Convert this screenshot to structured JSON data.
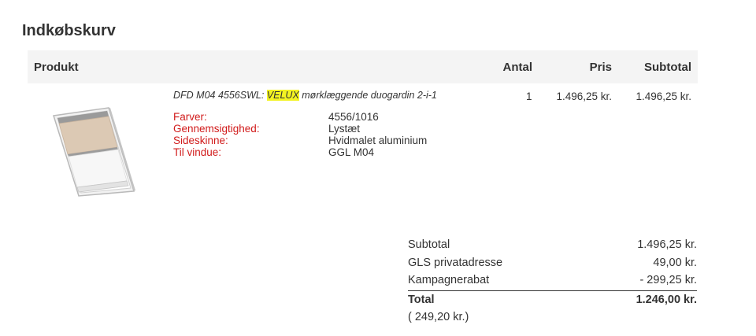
{
  "page": {
    "title": "Indkøbskurv"
  },
  "cart_header": {
    "product": "Produkt",
    "quantity": "Antal",
    "price": "Pris",
    "subtotal": "Subtotal"
  },
  "item": {
    "name_prefix": "DFD M04 4556SWL: ",
    "name_brand": "VELUX",
    "name_suffix": " mørklæggende duogardin 2-i-1",
    "quantity": "1",
    "price": "1.496,25 kr.",
    "subtotal": "1.496,25 kr.",
    "image_icon": "velux-window-blind-image",
    "attributes": [
      {
        "label": "Farver:",
        "value": "4556/1016"
      },
      {
        "label": "Gennemsigtighed:",
        "value": "Lystæt"
      },
      {
        "label": "Sideskinne:",
        "value": "Hvidmalet aluminium"
      },
      {
        "label": "Til vindue:",
        "value": "GGL M04"
      }
    ]
  },
  "totals": {
    "subtotal_label": "Subtotal",
    "subtotal_value": "1.496,25 kr.",
    "shipping_label": "GLS privatadresse",
    "shipping_value": "49,00 kr.",
    "discount_label": "Kampagnerabat",
    "discount_value": "- 299,25 kr.",
    "total_label": "Total",
    "total_value": "1.246,00 kr.",
    "vat_note": "( 249,20 kr.)"
  },
  "colors": {
    "attribute_label": "#d11b1b",
    "brand_highlight": "#f3f322",
    "header_background": "#f4f4f4",
    "blind_color": "#dcc9b4"
  }
}
